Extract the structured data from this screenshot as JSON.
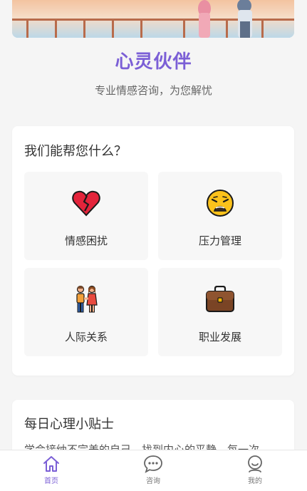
{
  "header": {
    "title": "心灵伙伴",
    "subtitle": "专业情感咨询，为您解忧"
  },
  "help": {
    "title": "我们能帮您什么？",
    "items": [
      {
        "label": "情感困扰",
        "icon": "broken-heart-icon"
      },
      {
        "label": "压力管理",
        "icon": "weary-face-icon"
      },
      {
        "label": "人际关系",
        "icon": "two-people-icon"
      },
      {
        "label": "职业发展",
        "icon": "briefcase-icon"
      }
    ]
  },
  "tips": {
    "title": "每日心理小贴士",
    "text": "学会接纳不完美的自己，找到内心的平静。每一次"
  },
  "tabbar": {
    "home": "首页",
    "consult": "咨询",
    "mine": "我的"
  },
  "colors": {
    "accent": "#7b5fd6",
    "background": "#f5f5f5",
    "card": "#ffffff",
    "tile": "#f7f7f7"
  }
}
